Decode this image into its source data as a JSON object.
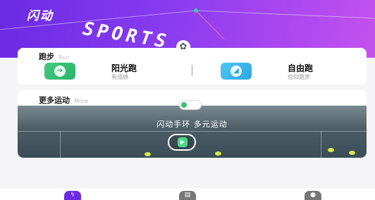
{
  "hero": {
    "brand": "闪动",
    "sports": "SPORTS",
    "accent": "#6a2be2"
  },
  "run": {
    "title": "跑步",
    "subtitle": "Run",
    "items": [
      {
        "name": "阳光跑",
        "desc": "有成绩",
        "icon": "run-shoe-icon",
        "color": "#2bb36b"
      },
      {
        "name": "自由跑",
        "desc": "信仰跑步",
        "icon": "sneaker-icon",
        "color": "#2ba6e0"
      }
    ]
  },
  "more": {
    "title": "更多运动",
    "subtitle": "More",
    "banner_text": "闪动手环  多元运动"
  },
  "tabbar": {
    "items": [
      {
        "icon": "lightning-icon",
        "active": true
      },
      {
        "icon": "calendar-icon",
        "active": false
      },
      {
        "icon": "profile-icon",
        "active": false
      }
    ]
  }
}
